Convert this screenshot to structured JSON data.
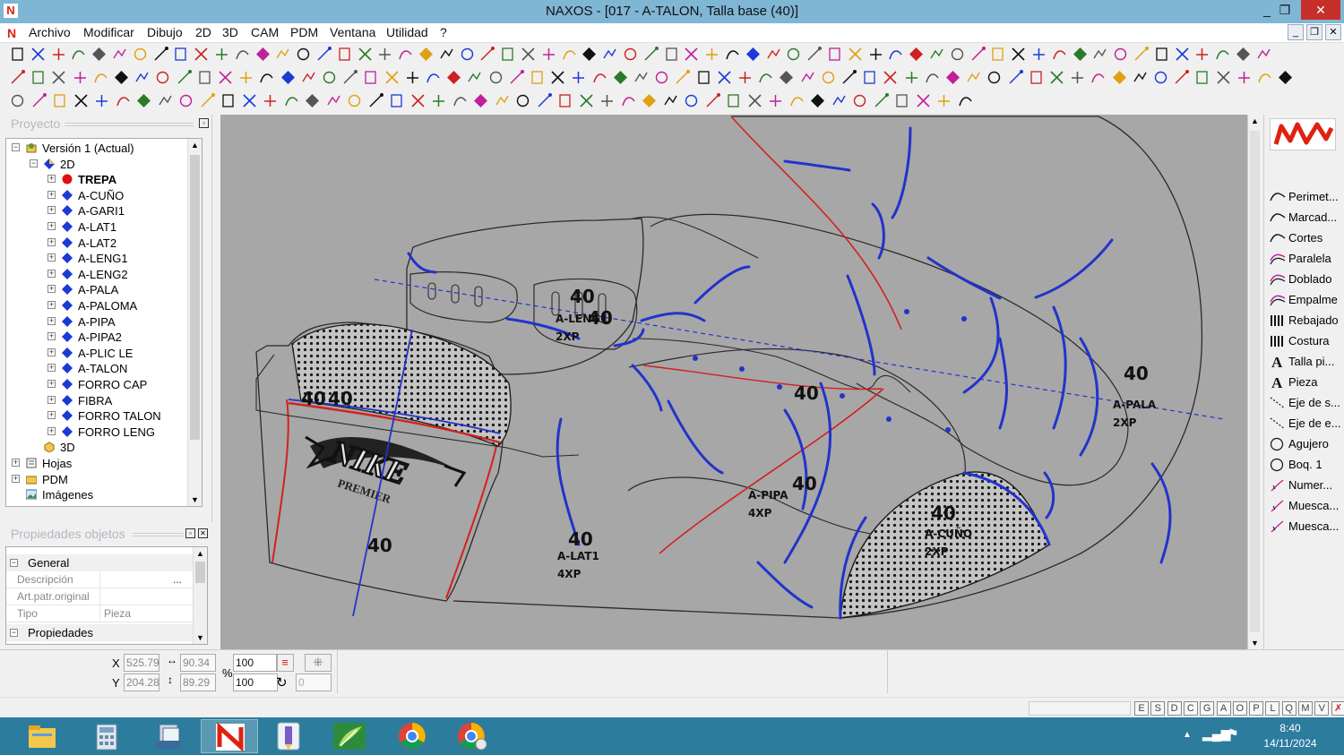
{
  "window": {
    "title": "NAXOS - [017 - A-TALON, Talla base (40)]",
    "app_icon_letter": "N",
    "controls": {
      "minimize": "_",
      "restore": "❐",
      "close": "✕"
    }
  },
  "menu": {
    "items": [
      "Archivo",
      "Modificar",
      "Dibujo",
      "2D",
      "3D",
      "CAM",
      "PDM",
      "Ventana",
      "Utilidad",
      "?"
    ],
    "mdi_controls": [
      "_",
      "❐",
      "✕"
    ]
  },
  "project_panel": {
    "title": "Proyecto",
    "tree": [
      {
        "label": "Versión 1 (Actual)",
        "icon": "version-icon",
        "level": 0,
        "expander": "-"
      },
      {
        "label": "2D",
        "icon": "2d-icon",
        "level": 1,
        "expander": "-"
      },
      {
        "label": "TREPA",
        "icon": "red-dot-icon",
        "level": 2,
        "expander": "+",
        "bold": true
      },
      {
        "label": "A-CUÑO",
        "icon": "diamond-icon",
        "level": 2,
        "expander": "+"
      },
      {
        "label": "A-GARI1",
        "icon": "diamond-icon",
        "level": 2,
        "expander": "+"
      },
      {
        "label": "A-LAT1",
        "icon": "diamond-icon",
        "level": 2,
        "expander": "+"
      },
      {
        "label": "A-LAT2",
        "icon": "diamond-icon",
        "level": 2,
        "expander": "+"
      },
      {
        "label": "A-LENG1",
        "icon": "diamond-icon",
        "level": 2,
        "expander": "+"
      },
      {
        "label": "A-LENG2",
        "icon": "diamond-icon",
        "level": 2,
        "expander": "+"
      },
      {
        "label": "A-PALA",
        "icon": "diamond-icon",
        "level": 2,
        "expander": "+"
      },
      {
        "label": "A-PALOMA",
        "icon": "diamond-icon",
        "level": 2,
        "expander": "+"
      },
      {
        "label": "A-PIPA",
        "icon": "diamond-icon",
        "level": 2,
        "expander": "+"
      },
      {
        "label": "A-PIPA2",
        "icon": "diamond-icon",
        "level": 2,
        "expander": "+"
      },
      {
        "label": "A-PLIC LE",
        "icon": "diamond-icon",
        "level": 2,
        "expander": "+"
      },
      {
        "label": "A-TALON",
        "icon": "diamond-icon",
        "level": 2,
        "expander": "+"
      },
      {
        "label": "FORRO CAP",
        "icon": "diamond-icon",
        "level": 2,
        "expander": "+"
      },
      {
        "label": "FIBRA",
        "icon": "diamond-icon",
        "level": 2,
        "expander": "+"
      },
      {
        "label": "FORRO TALON",
        "icon": "diamond-icon",
        "level": 2,
        "expander": "+"
      },
      {
        "label": "FORRO LENG",
        "icon": "diamond-icon",
        "level": 2,
        "expander": "+"
      },
      {
        "label": "3D",
        "icon": "3d-icon",
        "level": 1,
        "expander": ""
      },
      {
        "label": "Hojas",
        "icon": "sheets-icon",
        "level": 0,
        "expander": "+"
      },
      {
        "label": "PDM",
        "icon": "folder-icon",
        "level": 0,
        "expander": "+"
      },
      {
        "label": "Imágenes",
        "icon": "images-icon",
        "level": 0,
        "expander": ""
      }
    ]
  },
  "properties_panel": {
    "title": "Propiedades objetos",
    "sections": [
      {
        "name": "General",
        "rows": [
          {
            "key": "Descripción",
            "value": ""
          },
          {
            "key": "Art.patr.original",
            "value": ""
          },
          {
            "key": "Tipo",
            "value": "Pieza"
          }
        ]
      },
      {
        "name": "Propiedades",
        "rows": []
      }
    ]
  },
  "right_tools": [
    {
      "label": "Perimet...",
      "icon": "curve-icon"
    },
    {
      "label": "Marcad...",
      "icon": "curve-icon"
    },
    {
      "label": "Cortes",
      "icon": "curve-icon"
    },
    {
      "label": "Paralela",
      "icon": "parallel-curve-icon"
    },
    {
      "label": "Doblado",
      "icon": "parallel-curve-icon"
    },
    {
      "label": "Empalme",
      "icon": "parallel-curve-icon"
    },
    {
      "label": "Rebajado",
      "icon": "rebajado-icon"
    },
    {
      "label": "Costura",
      "icon": "rebajado-icon"
    },
    {
      "label": "Talla pi...",
      "icon": "text-a-icon"
    },
    {
      "label": "Pieza",
      "icon": "text-a-icon"
    },
    {
      "label": "Eje de s...",
      "icon": "axis-icon"
    },
    {
      "label": "Eje de e...",
      "icon": "axis-icon"
    },
    {
      "label": "Agujero",
      "icon": "circle-icon"
    },
    {
      "label": "Boq. 1",
      "icon": "circle-icon"
    },
    {
      "label": "Numer...",
      "icon": "notch-icon"
    },
    {
      "label": "Muesca...",
      "icon": "notch-icon"
    },
    {
      "label": "Muesca...",
      "icon": "notch-icon"
    }
  ],
  "canvas": {
    "size_labels": [
      "40",
      "40",
      "40",
      "40",
      "40",
      "40",
      "40",
      "40",
      "40",
      "40",
      "40"
    ],
    "piece_labels": [
      {
        "name": "A-LENG1",
        "qty": "2XP"
      },
      {
        "name": "A-PALA",
        "qty": "2XP"
      },
      {
        "name": "A-PIPA",
        "qty": "4XP"
      },
      {
        "name": "A-LAT1",
        "qty": "4XP"
      },
      {
        "name": "A-CUÑO",
        "qty": "2XP"
      }
    ],
    "logo_text": "NIKE",
    "logo_subtext": "PREMIER",
    "colors": {
      "background": "#a7a7a7",
      "outline": "#2a2a2a",
      "blue": "#2233cc",
      "red": "#d42020"
    }
  },
  "coordinates": {
    "x_label": "X",
    "y_label": "Y",
    "x": "525.79",
    "y": "204.28",
    "width": "90.34",
    "height": "89.29",
    "pct_symbol": "%",
    "scale_x": "100",
    "scale_y": "100",
    "rotation": "0"
  },
  "status_flags": [
    "E",
    "S",
    "D",
    "C",
    "G",
    "A",
    "O",
    "P",
    "L",
    "Q",
    "M",
    "V"
  ],
  "taskbar": {
    "apps": [
      "file-explorer-icon",
      "calculator-icon",
      "documents-icon",
      "naxos-icon",
      "pencil-app-icon",
      "leaf-app-icon",
      "chrome-icon",
      "chrome-profile-icon"
    ],
    "time": "8:40",
    "date": "14/11/2024"
  }
}
